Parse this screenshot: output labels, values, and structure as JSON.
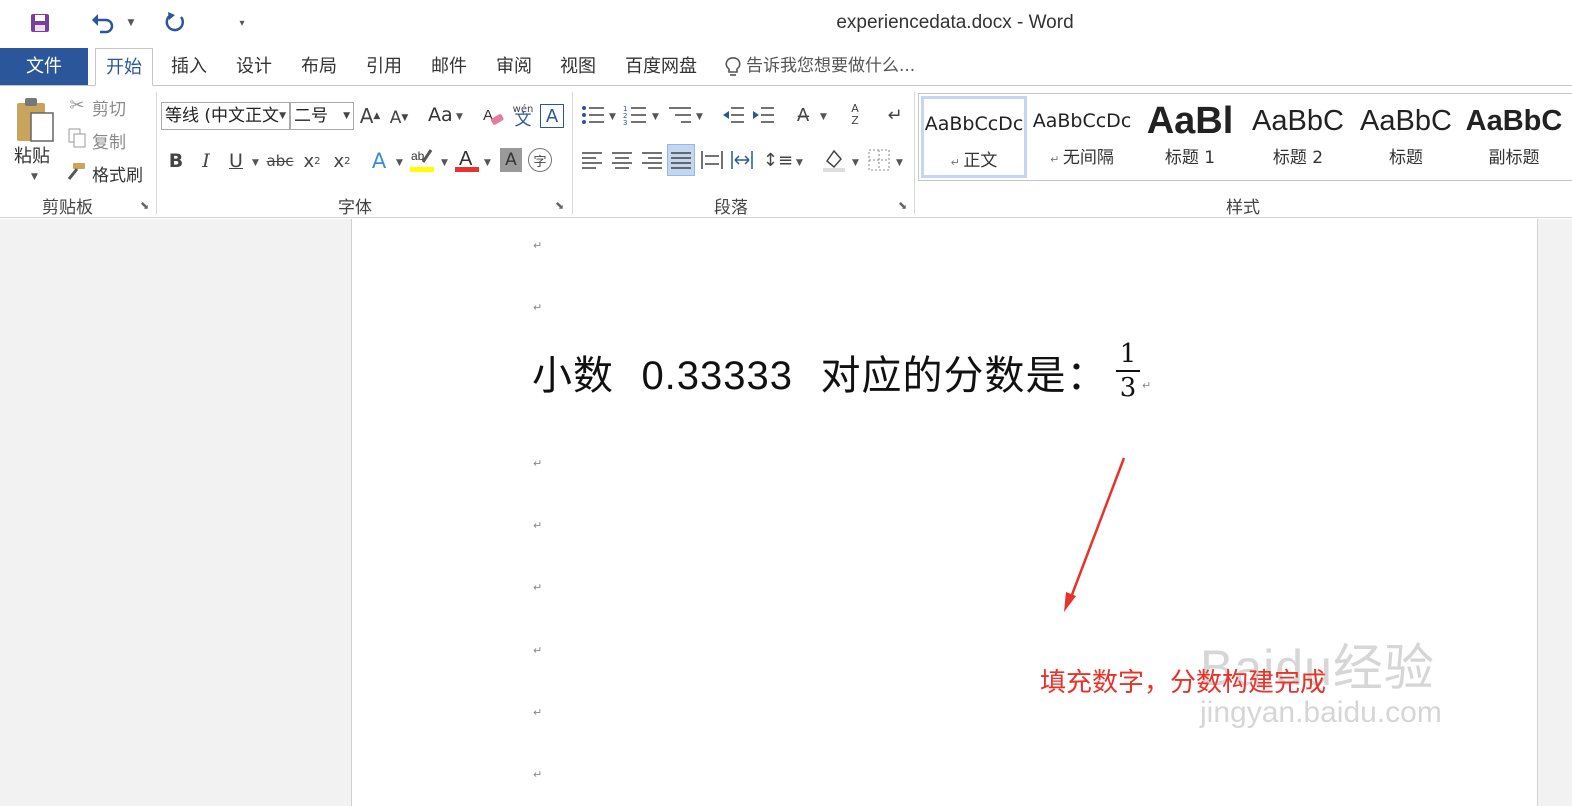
{
  "window": {
    "title": "experiencedata.docx - Word"
  },
  "quick_access": {
    "save_icon": "save-icon",
    "undo_icon": "undo-icon",
    "redo_icon": "redo-icon",
    "customize_icon": "customize-icon"
  },
  "tabs": [
    {
      "label": "文件"
    },
    {
      "label": "开始"
    },
    {
      "label": "插入"
    },
    {
      "label": "设计"
    },
    {
      "label": "布局"
    },
    {
      "label": "引用"
    },
    {
      "label": "邮件"
    },
    {
      "label": "审阅"
    },
    {
      "label": "视图"
    },
    {
      "label": "百度网盘"
    }
  ],
  "tell_me": {
    "placeholder": "告诉我您想要做什么..."
  },
  "clipboard": {
    "paste": "粘贴",
    "cut": "剪切",
    "copy": "复制",
    "format_painter": "格式刷",
    "group": "剪贴板"
  },
  "font": {
    "family": "等线 (中文正文",
    "size": "二号",
    "change_case": "Aa",
    "group": "字体"
  },
  "paragraph": {
    "group": "段落"
  },
  "styles": {
    "group": "样式",
    "items": [
      {
        "preview": "AaBbCcDc",
        "name": "正文"
      },
      {
        "preview": "AaBbCcDc",
        "name": "无间隔"
      },
      {
        "preview": "AaBl",
        "name": "标题 1"
      },
      {
        "preview": "AaBbC",
        "name": "标题 2"
      },
      {
        "preview": "AaBbC",
        "name": "标题"
      },
      {
        "preview": "AaBbC",
        "name": "副标题"
      }
    ]
  },
  "document": {
    "line_prefix": "小数",
    "decimal": "0.33333",
    "line_suffix": "对应的分数是：",
    "fraction": {
      "numerator": "1",
      "denominator": "3"
    },
    "paragraph_mark": "↵"
  },
  "annotation": {
    "text": "填充数字，分数构建完成",
    "color": "#e8322a"
  },
  "watermark": {
    "main": "Baidu经验",
    "sub": "jingyan.baidu.com"
  },
  "colors": {
    "accent": "#2b579a",
    "highlight": "#ffff00",
    "font_color": "#e8322a"
  }
}
